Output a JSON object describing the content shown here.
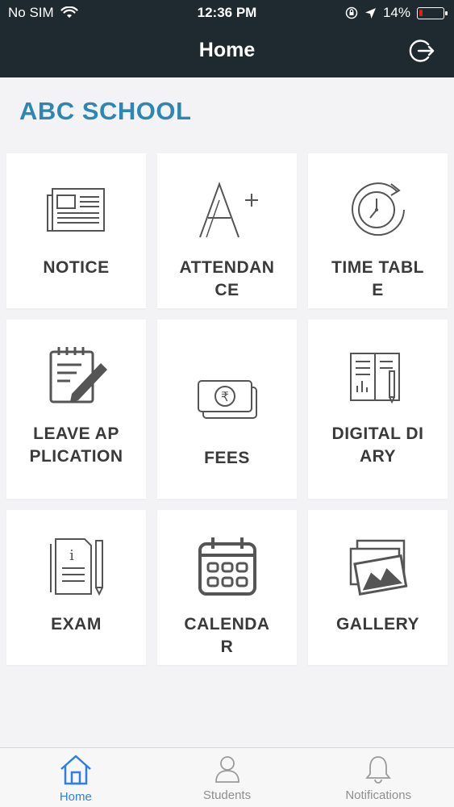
{
  "status_bar": {
    "carrier": "No SIM",
    "time": "12:36 PM",
    "battery_percent": "14%",
    "battery_level": 0.14
  },
  "header": {
    "title": "Home"
  },
  "school": {
    "name": "ABC SCHOOL"
  },
  "tiles": [
    {
      "label": "NOTICE",
      "icon": "newspaper-icon"
    },
    {
      "label": "ATTENDANCE",
      "icon": "grade-a-plus-icon"
    },
    {
      "label": "TIME TABLE",
      "icon": "clock-refresh-icon"
    },
    {
      "label": "LEAVE APPLICATION",
      "icon": "note-pencil-icon"
    },
    {
      "label": "FEES",
      "icon": "rupee-note-icon"
    },
    {
      "label": "DIGITAL DIARY",
      "icon": "book-pencil-icon"
    },
    {
      "label": "EXAM",
      "icon": "exam-paper-icon"
    },
    {
      "label": "CALENDAR",
      "icon": "calendar-icon"
    },
    {
      "label": "GALLERY",
      "icon": "photos-icon"
    }
  ],
  "tabbar": {
    "items": [
      {
        "label": "Home",
        "icon": "home-icon",
        "active": true
      },
      {
        "label": "Students",
        "icon": "person-icon",
        "active": false
      },
      {
        "label": "Notifications",
        "icon": "bell-icon",
        "active": false
      }
    ]
  },
  "colors": {
    "header_bg": "#1f2a30",
    "school_title": "#2e86b3",
    "tab_active": "#2f7fe0",
    "tab_inactive": "#8e8e8e"
  }
}
